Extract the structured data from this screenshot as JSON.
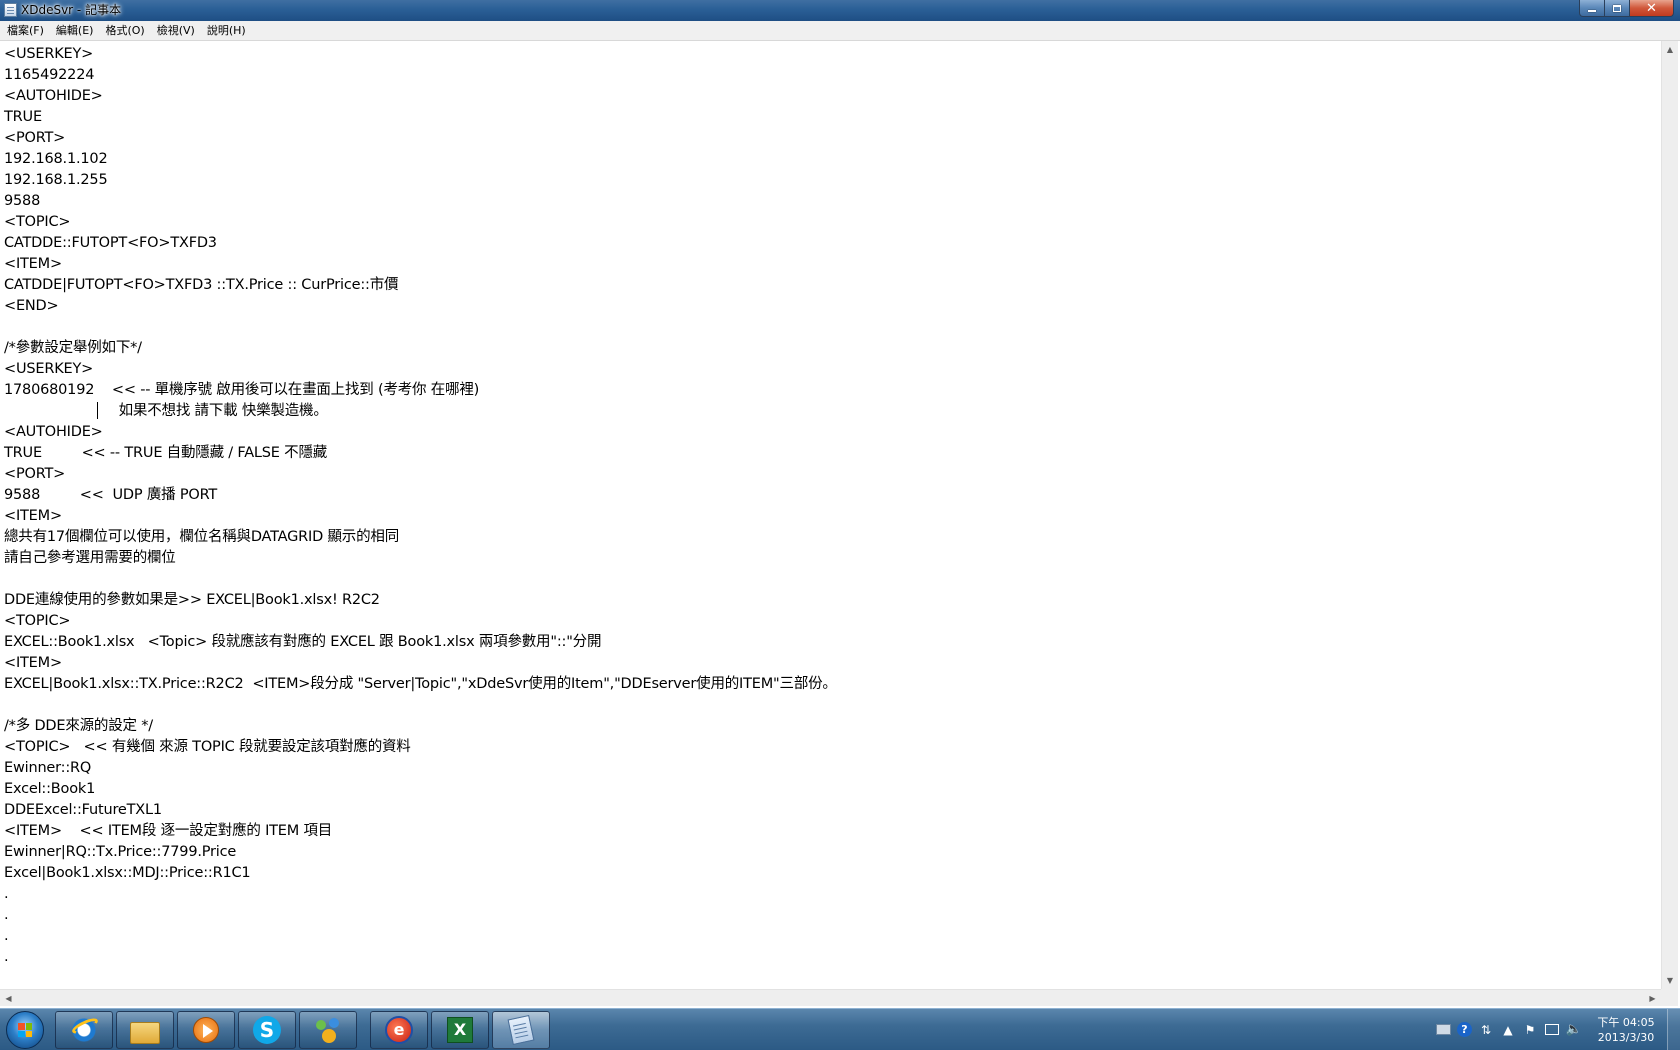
{
  "window": {
    "title": "XDdeSvr - 記事本"
  },
  "menu": {
    "items": [
      {
        "label": "檔案(F)"
      },
      {
        "label": "編輯(E)"
      },
      {
        "label": "格式(O)"
      },
      {
        "label": "檢視(V)"
      },
      {
        "label": "說明(H)"
      }
    ]
  },
  "editor": {
    "content": "<USERKEY>\n1165492224\n<AUTOHIDE>\nTRUE\n<PORT>\n192.168.1.102\n192.168.1.255\n9588\n<TOPIC>\nCATDDE::FUTOPT<FO>TXFD3\n<ITEM>\nCATDDE|FUTOPT<FO>TXFD3 ::TX.Price :: CurPrice::市價\n<END>\n\n/*參數設定舉例如下*/\n<USERKEY>\n1780680192    << -- 單機序號 啟用後可以在畫面上找到 (考考你 在哪裡)\n                          如果不想找 請下載 快樂製造機。\n<AUTOHIDE>\nTRUE         << -- TRUE 自動隱藏 / FALSE 不隱藏\n<PORT>\n9588         <<  UDP 廣播 PORT\n<ITEM>\n總共有17個欄位可以使用，欄位名稱與DATAGRID 顯示的相同\n請自己參考選用需要的欄位\n\nDDE連線使用的參數如果是>> EXCEL|Book1.xlsx! R2C2\n<TOPIC>\nEXCEL::Book1.xlsx   <Topic> 段就應該有對應的 EXCEL 跟 Book1.xlsx 兩項參數用\"::\"分開\n<ITEM>\nEXCEL|Book1.xlsx::TX.Price::R2C2  <ITEM>段分成 \"Server|Topic\",\"xDdeSvr使用的Item\",\"DDEserver使用的ITEM\"三部份。\n\n/*多 DDE來源的設定 */\n<TOPIC>   << 有幾個 來源 TOPIC 段就要設定該項對應的資料\nEwinner::RQ\nExcel::Book1\nDDEExcel::FutureTXL1\n<ITEM>    << ITEM段 逐一設定對應的 ITEM 項目\nEwinner|RQ::Tx.Price::7799.Price\nExcel|Book1.xlsx::MDJ::Price::R1C1\n.\n.\n.\n."
  },
  "taskbar": {
    "apps": [
      {
        "name": "internet-explorer"
      },
      {
        "name": "windows-explorer"
      },
      {
        "name": "media-player"
      },
      {
        "name": "skype"
      },
      {
        "name": "messenger"
      },
      {
        "name": "trading-app"
      },
      {
        "name": "excel"
      },
      {
        "name": "notepad"
      }
    ],
    "clock": {
      "time": "下午 04:05",
      "date": "2013/3/30"
    }
  }
}
